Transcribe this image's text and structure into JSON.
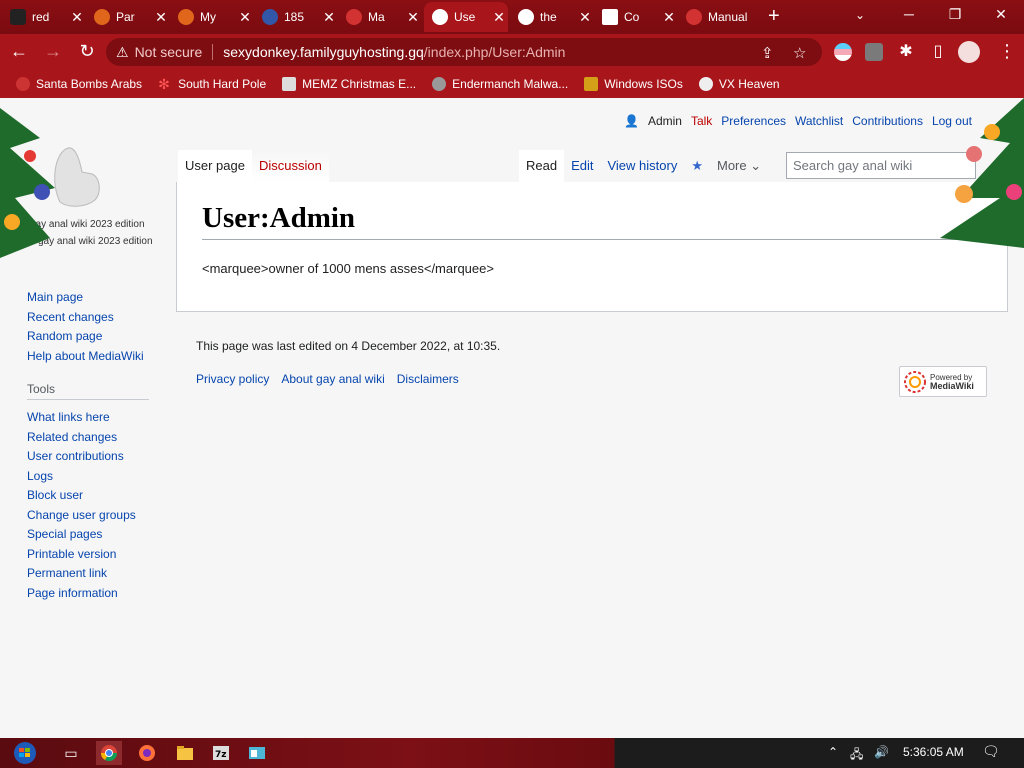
{
  "tabs": [
    {
      "title": "red",
      "favicon_color": "#222222"
    },
    {
      "title": "Par",
      "favicon_color": "#e0661c"
    },
    {
      "title": "My",
      "favicon_color": "#e0661c"
    },
    {
      "title": "185",
      "favicon_color": "#3357a8"
    },
    {
      "title": "Ma",
      "favicon_color": "#d23232"
    },
    {
      "title": "Use",
      "favicon_color": "#ffffff",
      "active": true
    },
    {
      "title": "the",
      "favicon_color": "#ffffff"
    },
    {
      "title": "Co",
      "favicon_color": "#ffffff"
    },
    {
      "title": "Manual",
      "favicon_color": "#d23232"
    }
  ],
  "toolbar": {
    "security_label": "Not secure",
    "url_host": "sexydonkey.familyguyhosting.gq",
    "url_path": "/index.php/User:Admin"
  },
  "bookmarks": [
    {
      "label": "Santa Bombs Arabs",
      "icon": "santa-icon"
    },
    {
      "label": "South Hard Pole",
      "icon": "snowflake-icon"
    },
    {
      "label": "MEMZ Christmas E...",
      "icon": "image-icon"
    },
    {
      "label": "Endermanch Malwa...",
      "icon": "raccoon-icon"
    },
    {
      "label": "Windows ISOs",
      "icon": "trophy-icon"
    },
    {
      "label": "VX Heaven",
      "icon": "skull-icon"
    }
  ],
  "personal": {
    "user": "Admin",
    "talk": "Talk",
    "preferences": "Preferences",
    "watchlist": "Watchlist",
    "contributions": "Contributions",
    "logout": "Log out"
  },
  "logo": {
    "caption1": "gay anal wiki 2023 edition",
    "caption2": "gay anal wiki 2023 edition"
  },
  "navigation": [
    "Main page",
    "Recent changes",
    "Random page",
    "Help about MediaWiki"
  ],
  "tools": {
    "heading": "Tools",
    "items": [
      "What links here",
      "Related changes",
      "User contributions",
      "Logs",
      "Block user",
      "Change user groups",
      "Special pages",
      "Printable version",
      "Permanent link",
      "Page information"
    ]
  },
  "page_tabs": {
    "user_page": "User page",
    "discussion": "Discussion"
  },
  "view_tabs": {
    "read": "Read",
    "edit": "Edit",
    "history": "View history",
    "more": "More"
  },
  "search": {
    "placeholder": "Search gay anal wiki"
  },
  "article": {
    "title": "User:Admin",
    "body": "<marquee>owner of 1000 mens asses</marquee>"
  },
  "footer": {
    "lastmod": "This page was last edited on 4 December 2022, at 10:35.",
    "links": [
      "Privacy policy",
      "About gay anal wiki",
      "Disclaimers"
    ],
    "powered_line1": "Powered by",
    "powered_line2": "MediaWiki"
  },
  "taskbar": {
    "clock": "5:36:05 AM"
  }
}
